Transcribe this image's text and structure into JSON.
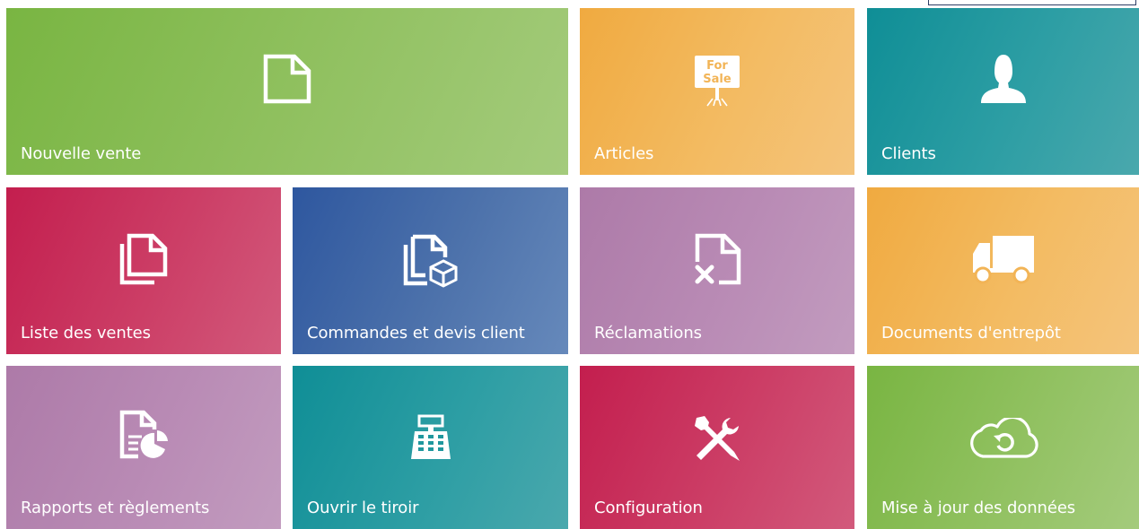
{
  "colors": {
    "green": "#8bbd57",
    "orange": "#f2b456",
    "teal": "#1f979e",
    "red": "#c93360",
    "blue": "#4467a6",
    "purple": "#b587b1",
    "text": "#ffffff"
  },
  "tiles": {
    "nouvelle_vente": {
      "label": "Nouvelle vente",
      "icon": "new-document-icon"
    },
    "articles": {
      "label": "Articles",
      "icon": "for-sale-sign-icon",
      "sign_line1": "For",
      "sign_line2": "Sale"
    },
    "clients": {
      "label": "Clients",
      "icon": "user-icon"
    },
    "liste_des_ventes": {
      "label": "Liste des ventes",
      "icon": "documents-icon"
    },
    "commandes": {
      "label": "Commandes et devis client",
      "icon": "documents-box-icon"
    },
    "reclamations": {
      "label": "Réclamations",
      "icon": "document-cross-icon"
    },
    "documents_entrepot": {
      "label": "Documents d'entrepôt",
      "icon": "truck-icon"
    },
    "rapports": {
      "label": "Rapports et règlements",
      "icon": "report-chart-icon"
    },
    "ouvrir_tiroir": {
      "label": "Ouvrir le tiroir",
      "icon": "cash-register-icon"
    },
    "configuration": {
      "label": "Configuration",
      "icon": "tools-icon"
    },
    "mise_a_jour": {
      "label": "Mise à jour des données",
      "icon": "cloud-sync-icon"
    }
  }
}
